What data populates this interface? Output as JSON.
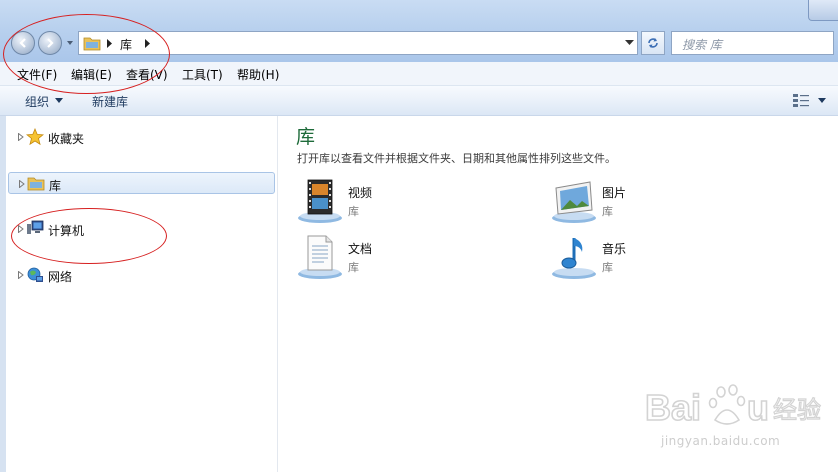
{
  "address": {
    "crumb": "库",
    "search_placeholder": "搜索 库"
  },
  "menu": {
    "items": [
      "文件(F)",
      "编辑(E)",
      "查看(V)",
      "工具(T)",
      "帮助(H)"
    ]
  },
  "toolbar": {
    "organize": "组织",
    "new_library": "新建库"
  },
  "nav": {
    "items": [
      {
        "label": "收藏夹",
        "icon": "star-icon"
      },
      {
        "label": "库",
        "icon": "library-folder-icon",
        "selected": true
      },
      {
        "label": "计算机",
        "icon": "computer-icon"
      },
      {
        "label": "网络",
        "icon": "network-icon"
      }
    ]
  },
  "content": {
    "heading": "库",
    "subtitle": "打开库以查看文件并根据文件夹、日期和其他属性排列这些文件。",
    "libraries": [
      {
        "name": "视频",
        "type": "库",
        "icon": "video-library-icon"
      },
      {
        "name": "图片",
        "type": "库",
        "icon": "pictures-library-icon"
      },
      {
        "name": "文档",
        "type": "库",
        "icon": "documents-library-icon"
      },
      {
        "name": "音乐",
        "type": "库",
        "icon": "music-library-icon"
      }
    ]
  },
  "colors": {
    "heading_green": "#1e6b3a",
    "annotation_red": "#d62020",
    "selection_blue": "#dce9f8"
  },
  "watermark": {
    "brand": "Baidu经验",
    "url": "jingyan.baidu.com"
  }
}
